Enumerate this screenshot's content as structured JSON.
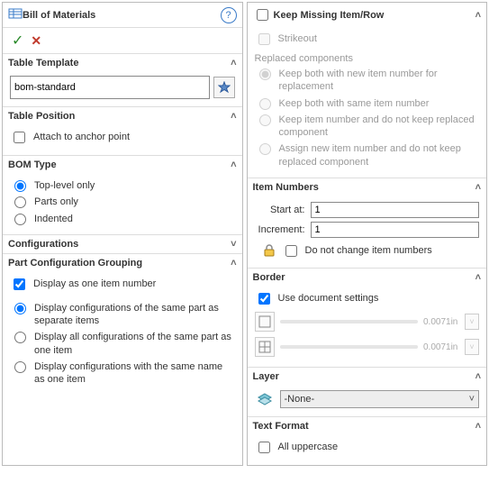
{
  "left": {
    "title": "Bill of Materials",
    "sections": {
      "template": {
        "header": "Table Template",
        "value": "bom-standard"
      },
      "position": {
        "header": "Table Position",
        "anchor": "Attach to anchor point"
      },
      "bom_type": {
        "header": "BOM Type",
        "opts": [
          "Top-level only",
          "Parts only",
          "Indented"
        ]
      },
      "configs": {
        "header": "Configurations"
      },
      "grouping": {
        "header": "Part Configuration Grouping",
        "display_one": "Display as one item number",
        "opt1": "Display configurations of the same part as separate items",
        "opt2": "Display all configurations of the same part as one item",
        "opt3": "Display configurations with the same name as one item"
      }
    }
  },
  "right": {
    "missing": {
      "header": "Keep Missing Item/Row",
      "strike": "Strikeout",
      "repl_hdr": "Replaced components",
      "o1": "Keep both with new item number for replacement",
      "o2": "Keep both with same item number",
      "o3": "Keep item number and do not keep replaced component",
      "o4": "Assign new item number and do not keep replaced component"
    },
    "nums": {
      "header": "Item Numbers",
      "start_lbl": "Start at:",
      "start": "1",
      "inc_lbl": "Increment:",
      "inc": "1",
      "lock": "Do not change item numbers"
    },
    "border": {
      "header": "Border",
      "use_doc": "Use document settings",
      "v": "0.0071in"
    },
    "layer": {
      "header": "Layer",
      "value": "-None-"
    },
    "text": {
      "header": "Text Format",
      "upper": "All uppercase"
    }
  }
}
